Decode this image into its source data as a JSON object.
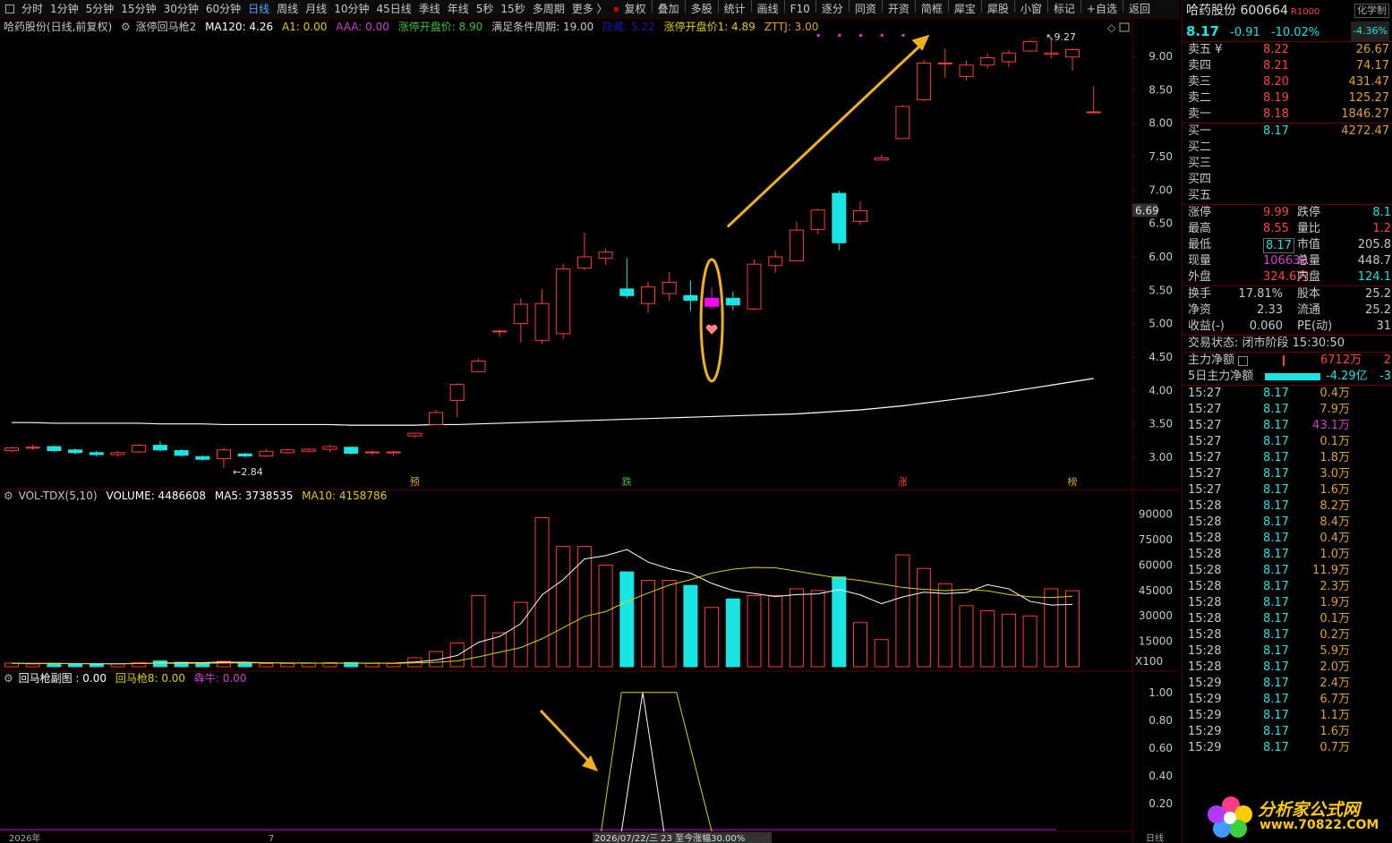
{
  "toolbar": {
    "periods": [
      "分时",
      "1分钟",
      "5分钟",
      "15分钟",
      "30分钟",
      "60分钟",
      "日线",
      "周线",
      "月线",
      "10分钟",
      "45日线",
      "季线",
      "年线",
      "5秒",
      "15秒",
      "多周期",
      "更多 〉"
    ],
    "active_index": 6,
    "tools": [
      "复权",
      "叠加",
      "多股",
      "统计",
      "画线",
      "F10",
      "逐分",
      "同资",
      "开资",
      "简框",
      "犀宝",
      "犀股",
      "小窗",
      "标记",
      "+自选",
      "返回"
    ]
  },
  "main_info": {
    "stock": "哈药股份(日线,前复权)",
    "indicator": "涨停回马枪2",
    "ma120": "MA120: 4.26",
    "a1": "A1: 0.00",
    "aaa": "AAA: 0.00",
    "zt_open": "涨停开盘价: 8.90",
    "period_cond": "满足条件周期: 19.00",
    "hidden": "隐藏: 5.22",
    "zt_open1": "涨停开盘价1: 4.89",
    "zttj": "ZTTJ: 3.00"
  },
  "vol_info": {
    "name": "VOL-TDX(5,10)",
    "volume": "VOLUME: 4486608",
    "ma5": "MA5: 3738535",
    "ma10": "MA10: 4158786"
  },
  "sub_info": {
    "name": "回马枪副图 : 0.00",
    "hmq8": "回马枪8: 0.00",
    "ju": "犇牛: 0.00"
  },
  "axis": {
    "price_ticks": [
      "9.00",
      "8.50",
      "8.00",
      "7.50",
      "7.00",
      "6.50",
      "6.00",
      "5.50",
      "5.00",
      "4.50",
      "4.00",
      "3.50",
      "3.00"
    ],
    "price_marker": "6.69",
    "vol_ticks": [
      "90000",
      "75000",
      "60000",
      "45000",
      "30000",
      "15000"
    ],
    "vol_unit": "X100",
    "sub_ticks": [
      "1.00",
      "0.80",
      "0.60",
      "0.40",
      "0.20"
    ],
    "bottom_left": "2026年",
    "bottom_mid": "7",
    "bottom_info": "2026/07/22/三 23 至今涨幅30.00%",
    "bottom_right": "日线"
  },
  "chart_labels": {
    "low": "2.84",
    "high": "9.27",
    "markers": [
      "预",
      "跌",
      "涨",
      "榜"
    ]
  },
  "chart_data": {
    "type": "candlestick",
    "ylim": [
      2.8,
      9.35
    ],
    "candles": [
      {
        "o": 3.1,
        "h": 3.16,
        "l": 3.07,
        "c": 3.14
      },
      {
        "o": 3.14,
        "h": 3.19,
        "l": 3.11,
        "c": 3.15
      },
      {
        "o": 3.16,
        "h": 3.18,
        "l": 3.08,
        "c": 3.1
      },
      {
        "o": 3.11,
        "h": 3.13,
        "l": 3.04,
        "c": 3.07
      },
      {
        "o": 3.07,
        "h": 3.1,
        "l": 3.01,
        "c": 3.04
      },
      {
        "o": 3.04,
        "h": 3.09,
        "l": 3.01,
        "c": 3.07
      },
      {
        "o": 3.08,
        "h": 3.2,
        "l": 3.06,
        "c": 3.18
      },
      {
        "o": 3.18,
        "h": 3.24,
        "l": 3.09,
        "c": 3.11
      },
      {
        "o": 3.1,
        "h": 3.12,
        "l": 3.01,
        "c": 3.03
      },
      {
        "o": 3.01,
        "h": 3.03,
        "l": 2.95,
        "c": 2.97
      },
      {
        "o": 2.98,
        "h": 3.14,
        "l": 2.84,
        "c": 3.11
      },
      {
        "o": 3.05,
        "h": 3.07,
        "l": 3.0,
        "c": 3.02
      },
      {
        "o": 3.02,
        "h": 3.12,
        "l": 3.0,
        "c": 3.09
      },
      {
        "o": 3.07,
        "h": 3.13,
        "l": 3.05,
        "c": 3.11
      },
      {
        "o": 3.09,
        "h": 3.14,
        "l": 3.07,
        "c": 3.12
      },
      {
        "o": 3.12,
        "h": 3.19,
        "l": 3.08,
        "c": 3.16
      },
      {
        "o": 3.15,
        "h": 3.16,
        "l": 3.04,
        "c": 3.06
      },
      {
        "o": 3.07,
        "h": 3.11,
        "l": 3.03,
        "c": 3.08
      },
      {
        "o": 3.07,
        "h": 3.1,
        "l": 3.02,
        "c": 3.08
      },
      {
        "o": 3.32,
        "h": 3.37,
        "l": 3.29,
        "c": 3.36
      },
      {
        "o": 3.49,
        "h": 3.71,
        "l": 3.48,
        "c": 3.67
      },
      {
        "o": 3.85,
        "h": 4.11,
        "l": 3.6,
        "c": 4.09
      },
      {
        "o": 4.28,
        "h": 4.48,
        "l": 4.28,
        "c": 4.44
      },
      {
        "o": 4.89,
        "h": 4.92,
        "l": 4.8,
        "c": 4.89
      },
      {
        "o": 5.0,
        "h": 5.38,
        "l": 4.72,
        "c": 5.29
      },
      {
        "o": 4.75,
        "h": 5.52,
        "l": 4.7,
        "c": 5.3
      },
      {
        "o": 4.85,
        "h": 5.9,
        "l": 4.77,
        "c": 5.82
      },
      {
        "o": 5.83,
        "h": 6.36,
        "l": 5.8,
        "c": 6.0
      },
      {
        "o": 5.98,
        "h": 6.12,
        "l": 5.88,
        "c": 6.07
      },
      {
        "o": 5.52,
        "h": 5.98,
        "l": 5.38,
        "c": 5.42
      },
      {
        "o": 5.3,
        "h": 5.63,
        "l": 5.16,
        "c": 5.55
      },
      {
        "o": 5.45,
        "h": 5.77,
        "l": 5.34,
        "c": 5.62
      },
      {
        "o": 5.42,
        "h": 5.65,
        "l": 5.19,
        "c": 5.35
      },
      {
        "o": 5.26,
        "h": 5.54,
        "l": 5.22,
        "c": 5.38
      },
      {
        "o": 5.38,
        "h": 5.48,
        "l": 5.2,
        "c": 5.28
      },
      {
        "o": 5.22,
        "h": 5.96,
        "l": 5.2,
        "c": 5.89
      },
      {
        "o": 5.87,
        "h": 6.1,
        "l": 5.76,
        "c": 6.0
      },
      {
        "o": 5.94,
        "h": 6.53,
        "l": 5.94,
        "c": 6.4
      },
      {
        "o": 6.41,
        "h": 6.72,
        "l": 6.34,
        "c": 6.7
      },
      {
        "o": 6.95,
        "h": 6.99,
        "l": 6.1,
        "c": 6.21
      },
      {
        "o": 6.53,
        "h": 6.83,
        "l": 6.48,
        "c": 6.69
      },
      {
        "o": 7.45,
        "h": 7.53,
        "l": 7.45,
        "c": 7.48
      },
      {
        "o": 7.77,
        "h": 8.27,
        "l": 7.77,
        "c": 8.25
      },
      {
        "o": 8.35,
        "h": 8.95,
        "l": 8.33,
        "c": 8.9
      },
      {
        "o": 8.9,
        "h": 9.12,
        "l": 8.68,
        "c": 8.9
      },
      {
        "o": 8.7,
        "h": 8.94,
        "l": 8.64,
        "c": 8.87
      },
      {
        "o": 8.87,
        "h": 9.04,
        "l": 8.82,
        "c": 8.98
      },
      {
        "o": 8.92,
        "h": 9.1,
        "l": 8.84,
        "c": 9.05
      },
      {
        "o": 9.08,
        "h": 9.24,
        "l": 9.06,
        "c": 9.22
      },
      {
        "o": 9.03,
        "h": 9.27,
        "l": 8.97,
        "c": 9.05
      },
      {
        "o": 8.99,
        "h": 9.12,
        "l": 8.79,
        "c": 9.1
      },
      {
        "o": 8.17,
        "h": 8.55,
        "l": 8.17,
        "c": 8.17
      }
    ],
    "ma120": [
      3.52,
      3.52,
      3.51,
      3.51,
      3.51,
      3.51,
      3.51,
      3.5,
      3.5,
      3.5,
      3.49,
      3.49,
      3.49,
      3.49,
      3.49,
      3.49,
      3.48,
      3.48,
      3.48,
      3.48,
      3.49,
      3.49,
      3.5,
      3.51,
      3.52,
      3.53,
      3.54,
      3.55,
      3.56,
      3.57,
      3.58,
      3.59,
      3.6,
      3.61,
      3.62,
      3.63,
      3.64,
      3.65,
      3.67,
      3.69,
      3.71,
      3.74,
      3.77,
      3.81,
      3.85,
      3.89,
      3.93,
      3.98,
      4.03,
      4.08,
      4.13,
      4.18
    ],
    "volume": [
      2100,
      1600,
      2000,
      1800,
      1500,
      1700,
      2400,
      3400,
      2600,
      2000,
      3200,
      2000,
      1800,
      1900,
      2000,
      2400,
      2500,
      1900,
      1800,
      5300,
      9000,
      14000,
      42000,
      20000,
      38000,
      88000,
      71000,
      71000,
      60000,
      56000,
      51000,
      51000,
      48000,
      35000,
      40000,
      42000,
      42000,
      46000,
      45000,
      53000,
      26000,
      16000,
      66000,
      58000,
      49000,
      36000,
      33000,
      31000,
      30000,
      46000,
      44866
    ],
    "vol_ma5": [
      2000,
      1900,
      1900,
      1800,
      1750,
      1720,
      1880,
      2160,
      2320,
      2420,
      2680,
      2640,
      2320,
      2180,
      2180,
      2060,
      2120,
      2100,
      2120,
      2780,
      3900,
      6600,
      14400,
      17800,
      25400,
      42400,
      51400,
      63600,
      65600,
      69200,
      61800,
      57800,
      55200,
      49200,
      45000,
      43200,
      41400,
      42600,
      43000,
      45600,
      42400,
      37200,
      41200,
      44000,
      43200,
      43800,
      48400,
      46000,
      38600,
      36400,
      36800
    ],
    "vol_ma10": [
      2000,
      1950,
      1930,
      1900,
      1880,
      1860,
      1880,
      1950,
      2000,
      2080,
      2200,
      2240,
      2220,
      2180,
      2160,
      2080,
      2050,
      2030,
      2040,
      2260,
      2600,
      3400,
      5800,
      8600,
      11300,
      16500,
      23000,
      29700,
      32500,
      38500,
      43500,
      48200,
      51400,
      55300,
      57600,
      58600,
      58400,
      56400,
      54300,
      52300,
      50900,
      48800,
      46800,
      45700,
      44900,
      45700,
      44800,
      42600,
      41300,
      40800,
      41587
    ]
  },
  "quote": {
    "name": "哈药股份 600664",
    "r1000": "R1000",
    "tag": "化学制",
    "price": "8.17",
    "change": "-0.91",
    "pct": "-10.02%",
    "tag2": "-4.36%",
    "asks": [
      {
        "label": "卖五 ¥",
        "price": "8.22",
        "vol": "26.67"
      },
      {
        "label": "卖四",
        "price": "8.21",
        "vol": "74.17"
      },
      {
        "label": "卖三",
        "price": "8.20",
        "vol": "431.47"
      },
      {
        "label": "卖二",
        "price": "8.19",
        "vol": "125.27"
      },
      {
        "label": "卖一",
        "price": "8.18",
        "vol": "1846.27"
      }
    ],
    "bids": [
      {
        "label": "买一",
        "price": "8.17",
        "vol": "4272.47"
      },
      {
        "label": "买二",
        "price": "",
        "vol": ""
      },
      {
        "label": "买三",
        "price": "",
        "vol": ""
      },
      {
        "label": "买四",
        "price": "",
        "vol": ""
      },
      {
        "label": "买五",
        "price": "",
        "vol": ""
      }
    ],
    "stats": [
      {
        "l1": "涨停",
        "v1": "9.99",
        "c1": "up",
        "l2": "跌停",
        "v2": "8.1",
        "c2": "dn"
      },
      {
        "l1": "最高",
        "v1": "8.55",
        "c1": "up",
        "l2": "量比",
        "v2": "1.2",
        "c2": "up"
      },
      {
        "l1": "最低",
        "v1": "8.17",
        "c1": "dn",
        "l2": "市值",
        "v2": "205.8",
        "c2": "wh"
      },
      {
        "l1": "现量",
        "v1": "106638",
        "c1": "pu",
        "l2": "总量",
        "v2": "448.7",
        "c2": "wh"
      },
      {
        "l1": "外盘",
        "v1": "324.6万",
        "c1": "up",
        "l2": "内盘",
        "v2": "124.1",
        "c2": "dn"
      }
    ],
    "stats2": [
      {
        "l1": "换手",
        "v1": "17.81%",
        "c1": "wh",
        "l2": "股本",
        "v2": "25.2"
      },
      {
        "l1": "净资",
        "v1": "2.33",
        "c1": "wh",
        "l2": "流通",
        "v2": "25.2"
      },
      {
        "l1": "收益(-)",
        "v1": "0.060",
        "c1": "wh",
        "l2": "PE(动)",
        "v2": "31"
      }
    ],
    "status": "交易状态: 闭市阶段 15:30:50",
    "main_net_label": "主力净额",
    "main_net": "6712万",
    "main_net_suffix": "2",
    "five_day_label": "5日主力净额",
    "five_day": "-4.29亿",
    "five_day_suffix": "-3"
  },
  "ticks": [
    {
      "t": "15:27",
      "p": "8.17",
      "v": "0.4万",
      "c": ""
    },
    {
      "t": "15:27",
      "p": "8.17",
      "v": "7.9万",
      "c": ""
    },
    {
      "t": "15:27",
      "p": "8.17",
      "v": "43.1万",
      "c": "pu"
    },
    {
      "t": "15:27",
      "p": "8.17",
      "v": "0.1万",
      "c": ""
    },
    {
      "t": "15:27",
      "p": "8.17",
      "v": "1.8万",
      "c": ""
    },
    {
      "t": "15:27",
      "p": "8.17",
      "v": "3.0万",
      "c": ""
    },
    {
      "t": "15:27",
      "p": "8.17",
      "v": "1.6万",
      "c": ""
    },
    {
      "t": "15:28",
      "p": "8.17",
      "v": "8.2万",
      "c": ""
    },
    {
      "t": "15:28",
      "p": "8.17",
      "v": "8.4万",
      "c": ""
    },
    {
      "t": "15:28",
      "p": "8.17",
      "v": "0.4万",
      "c": ""
    },
    {
      "t": "15:28",
      "p": "8.17",
      "v": "1.0万",
      "c": ""
    },
    {
      "t": "15:28",
      "p": "8.17",
      "v": "11.9万",
      "c": ""
    },
    {
      "t": "15:28",
      "p": "8.17",
      "v": "2.3万",
      "c": ""
    },
    {
      "t": "15:28",
      "p": "8.17",
      "v": "1.9万",
      "c": ""
    },
    {
      "t": "15:28",
      "p": "8.17",
      "v": "0.1万",
      "c": ""
    },
    {
      "t": "15:28",
      "p": "8.17",
      "v": "0.2万",
      "c": ""
    },
    {
      "t": "15:28",
      "p": "8.17",
      "v": "5.9万",
      "c": ""
    },
    {
      "t": "15:28",
      "p": "8.17",
      "v": "2.0万",
      "c": ""
    },
    {
      "t": "15:29",
      "p": "8.17",
      "v": "2.4万",
      "c": ""
    },
    {
      "t": "15:29",
      "p": "8.17",
      "v": "6.7万",
      "c": ""
    },
    {
      "t": "15:29",
      "p": "8.17",
      "v": "1.1万",
      "c": ""
    },
    {
      "t": "15:29",
      "p": "8.17",
      "v": "1.6万",
      "c": ""
    },
    {
      "t": "15:29",
      "p": "8.17",
      "v": "0.7万",
      "c": ""
    }
  ],
  "watermark": {
    "text": "分析家公式网",
    "url": "www.70822.COM"
  },
  "colors": {
    "up": "#ff3b3b",
    "down": "#19e5e5",
    "ma": "#ffffff",
    "vol_ma10": "#e0d000",
    "highlight": "#ff00ff",
    "annot": "#f0b020"
  }
}
